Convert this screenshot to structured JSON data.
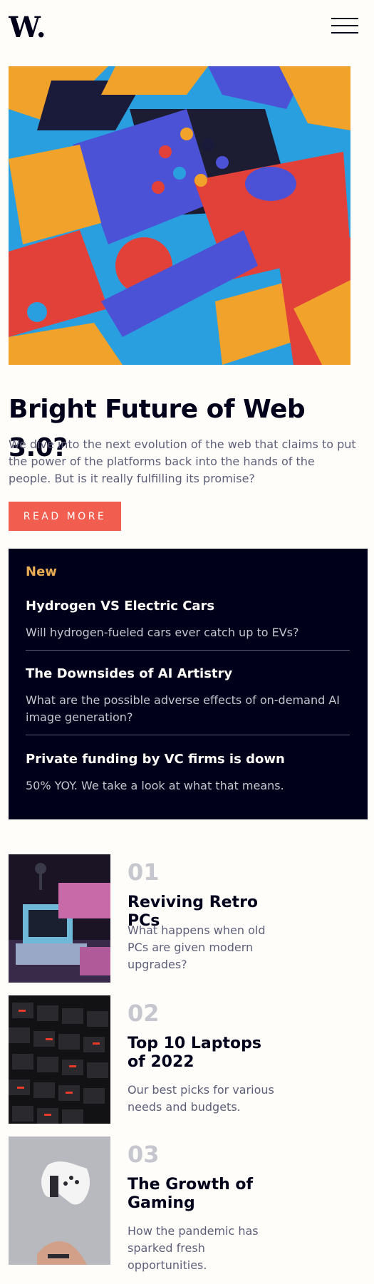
{
  "header": {
    "logo_text": "W.",
    "menu_icon": "hamburger-icon"
  },
  "hero": {
    "image_alt": "colorful 3D geometric blocks",
    "title": "Bright Future of Web 3.0?",
    "description": "We dive into the next evolution of the web that claims to put the power of the platforms back into the hands of the people. But is it really fulfilling its promise?",
    "button_label": "READ MORE"
  },
  "new_section": {
    "heading": "New",
    "items": [
      {
        "title": "Hydrogen VS Electric Cars",
        "description": "Will hydrogen-fueled cars ever catch up to EVs?"
      },
      {
        "title": "The Downsides of AI Artistry",
        "description": "What are the possible adverse effects of on-demand AI image generation?"
      },
      {
        "title": "Private funding by VC firms is down",
        "description": "50% YOY. We take a look at what that means."
      }
    ]
  },
  "articles": [
    {
      "number": "01",
      "title": "Reviving Retro PCs",
      "description": "What happens when old PCs are given modern upgrades?"
    },
    {
      "number": "02",
      "title": "Top 10 Laptops of 2022",
      "description": "Our best picks for various needs and budgets."
    },
    {
      "number": "03",
      "title": "The Growth of Gaming",
      "description": "How the pandemic has sparked fresh opportunities."
    }
  ],
  "colors": {
    "background": "#fffdfa",
    "dark": "#00001a",
    "accent_red": "#f15e50",
    "accent_orange": "#e9ab53",
    "grayish_blue": "#5d5f79",
    "light_gray": "#c5c6ce"
  }
}
